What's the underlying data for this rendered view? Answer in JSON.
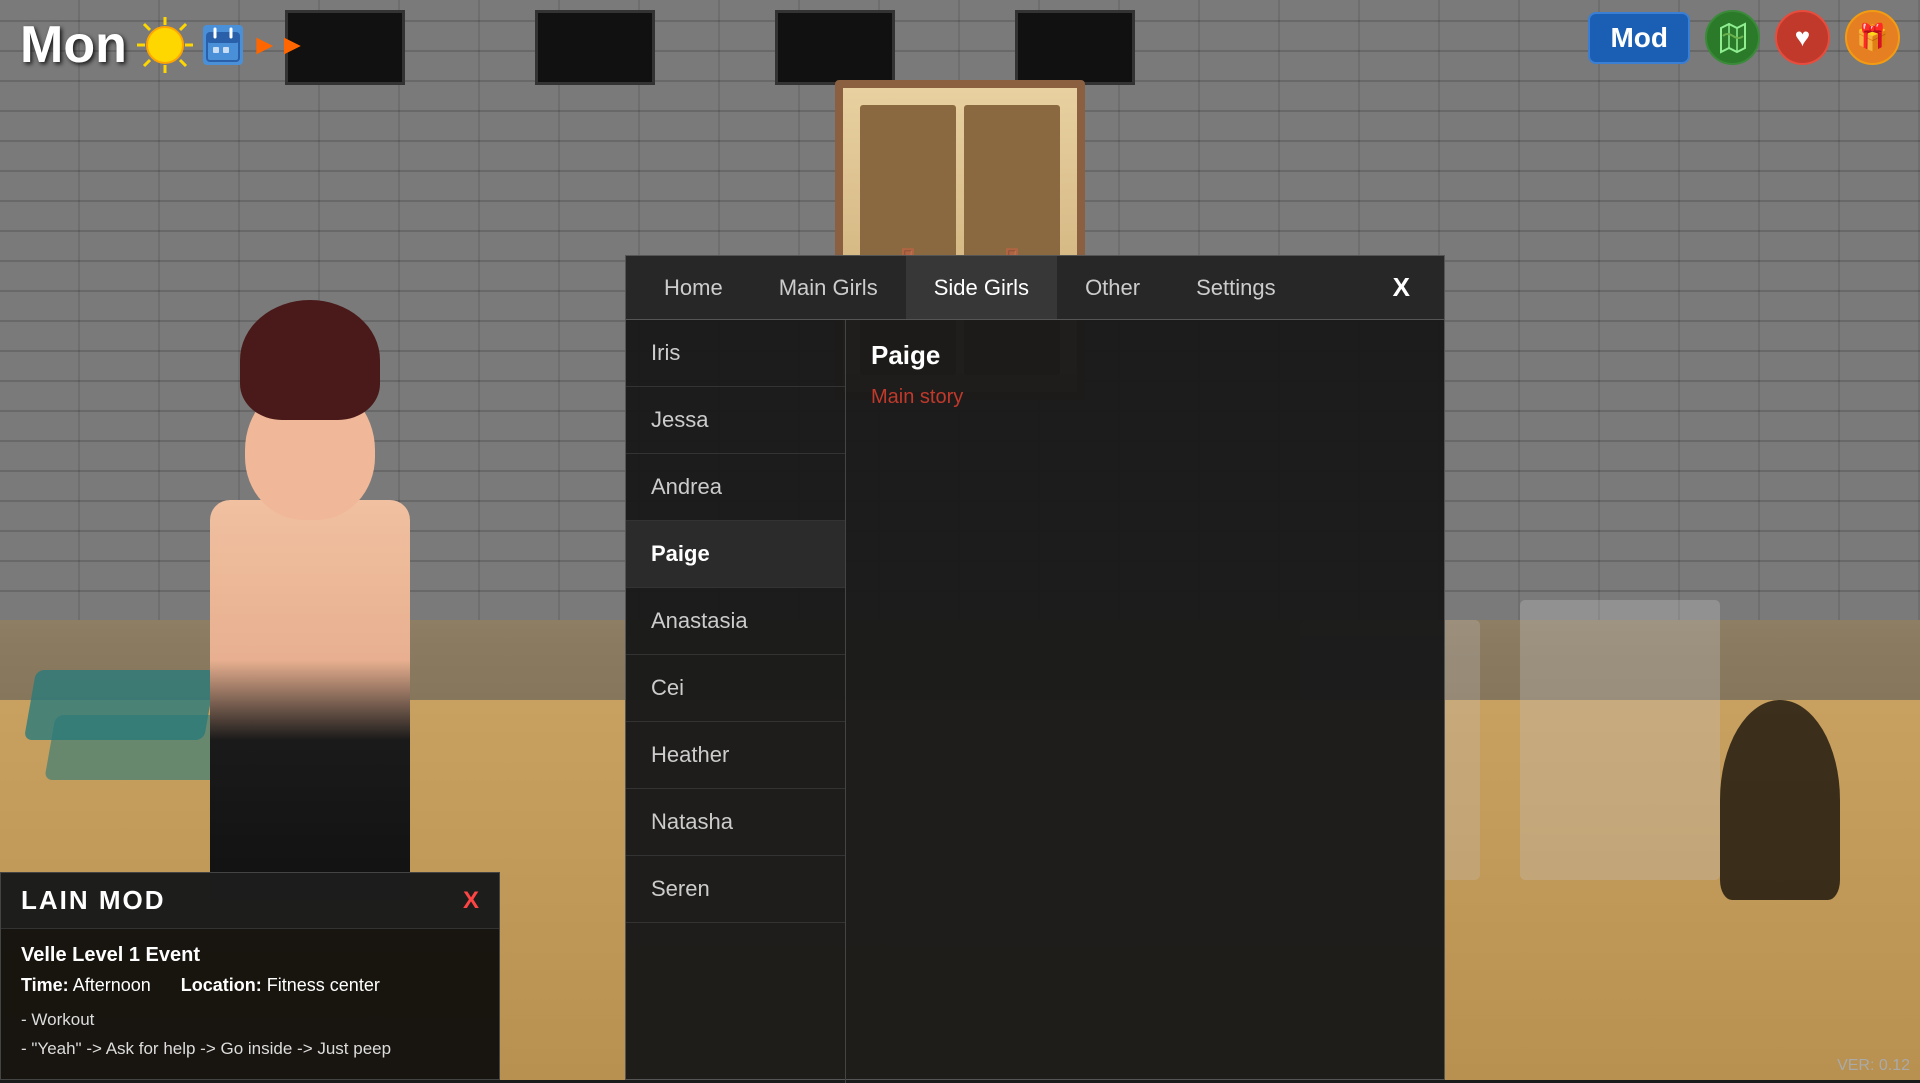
{
  "hud": {
    "day": "Mon",
    "mod_button": "Mod",
    "version": "VER: 0.12"
  },
  "tabs": {
    "items": [
      {
        "id": "home",
        "label": "Home"
      },
      {
        "id": "main_girls",
        "label": "Main Girls"
      },
      {
        "id": "side_girls",
        "label": "Side Girls"
      },
      {
        "id": "other",
        "label": "Other"
      },
      {
        "id": "settings",
        "label": "Settings"
      }
    ],
    "active": "side_girls",
    "close_label": "X"
  },
  "side_girls": {
    "selected": "Paige",
    "list": [
      {
        "name": "Iris"
      },
      {
        "name": "Jessa"
      },
      {
        "name": "Andrea"
      },
      {
        "name": "Paige"
      },
      {
        "name": "Anastasia"
      },
      {
        "name": "Cei"
      },
      {
        "name": "Heather"
      },
      {
        "name": "Natasha"
      },
      {
        "name": "Seren"
      }
    ],
    "detail": {
      "name": "Paige",
      "story_link": "Main story"
    }
  },
  "info_box": {
    "title": "LAIN MOD",
    "close_label": "X",
    "event_title": "Velle Level 1 Event",
    "time_label": "Time:",
    "time_value": "Afternoon",
    "location_label": "Location:",
    "location_value": "Fitness center",
    "steps": [
      "- Workout",
      "- \"Yeah\" -> Ask for help -> Go inside -> Just peep"
    ]
  }
}
